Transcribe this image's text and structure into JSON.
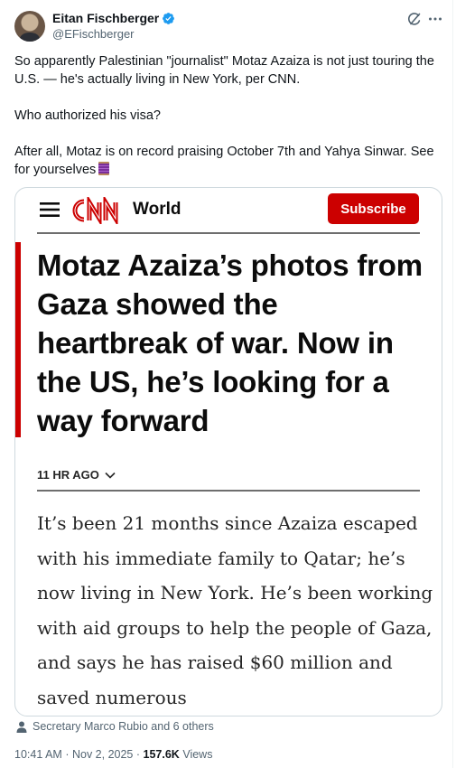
{
  "author": {
    "display_name": "Eitan Fischberger",
    "handle": "@EFischberger",
    "verified_icon": "verified-badge-icon"
  },
  "header_icons": {
    "grok": "grok-icon",
    "more": "more-options-icon"
  },
  "tweet": {
    "line1": "So apparently Palestinian \"journalist\" Motaz Azaiza is not just touring the U.S. — he's actually living in New York, per CNN.",
    "line2": "Who authorized his visa?",
    "line3": "After all, Motaz is on record praising October 7th and Yahya Sinwar. See for yourselves",
    "emoji": "thread-spool-emoji"
  },
  "media": {
    "section": "World",
    "subscribe_label": "Subscribe",
    "headline": "Motaz Azaiza’s photos from Gaza showed the heartbreak of war. Now in the US, he’s looking for a way forward",
    "timestamp": "11 HR AGO",
    "body": "It’s been 21 months since Azaiza escaped with his immediate family to Qatar; he’s now living in New York. He’s been working with aid groups to help the people of Gaza, and says he has raised $60 million and saved numerous",
    "brand_color": "#cc0000"
  },
  "social_context": "Secretary Marco Rubio and 6 others",
  "meta": {
    "time": "10:41 AM",
    "date": "Nov 2, 2025",
    "views_count": "157.6K",
    "views_label": "Views",
    "separator": "·"
  }
}
